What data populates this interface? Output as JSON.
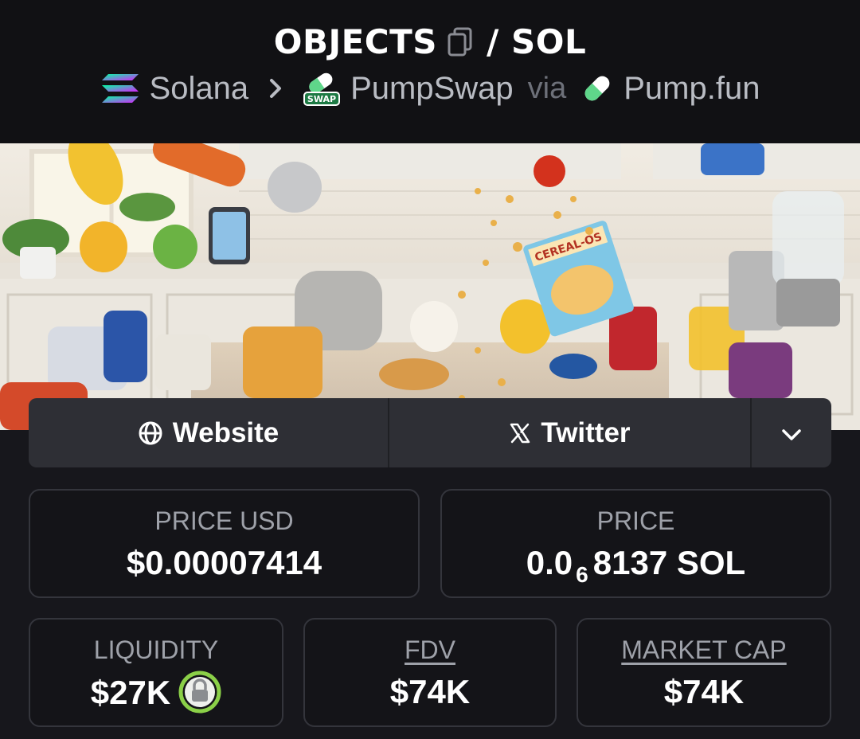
{
  "header": {
    "token_symbol": "OBJECTS",
    "quote_symbol": "/ SOL",
    "breadcrumb": {
      "chain": "Solana",
      "dex": "PumpSwap",
      "dex_badge": "SWAP",
      "via": "via",
      "launchpad": "Pump.fun"
    }
  },
  "banner": {
    "box_text": "CEREAL-OS"
  },
  "links": {
    "website": "Website",
    "twitter": "Twitter"
  },
  "stats": {
    "price_usd": {
      "label": "PRICE USD",
      "value": "$0.00007414"
    },
    "price": {
      "label": "PRICE",
      "prefix": "0.0",
      "zeros": "6",
      "suffix": "8137 SOL"
    },
    "liquidity": {
      "label": "LIQUIDITY",
      "value": "$27K"
    },
    "fdv": {
      "label": "FDV",
      "value": "$74K"
    },
    "market_cap": {
      "label": "MARKET CAP",
      "value": "$74K"
    }
  },
  "icons": {
    "copy": "copy-icon",
    "chain": "solana-logo-icon",
    "dex": "pumpswap-logo-icon",
    "launchpad": "pumpfun-pill-icon",
    "website": "globe-icon",
    "twitter": "x-logo-icon",
    "more": "chevron-down-icon",
    "lock": "lock-icon"
  },
  "colors": {
    "background": "#17171c",
    "header_bg": "#111114",
    "lock_green": "#8bd048",
    "muted_text": "#9ea1a9"
  }
}
